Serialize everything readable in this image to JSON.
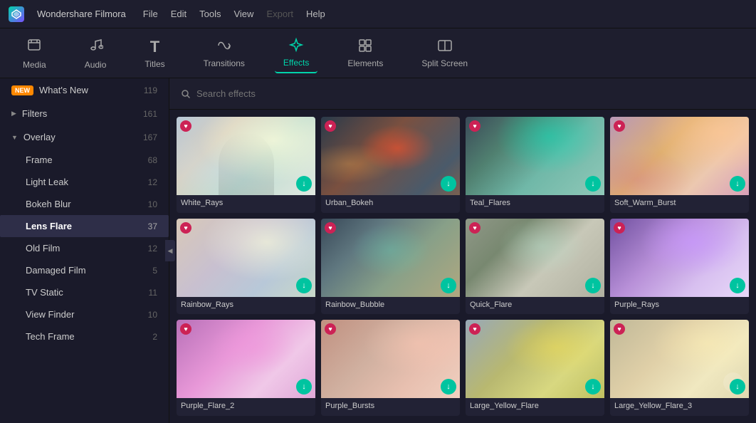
{
  "app": {
    "logo": "W",
    "name": "Wondershare Filmora",
    "menu": [
      "File",
      "Edit",
      "Tools",
      "View",
      "Export",
      "Help"
    ]
  },
  "toolbar": {
    "items": [
      {
        "id": "media",
        "label": "Media",
        "icon": "🗂"
      },
      {
        "id": "audio",
        "label": "Audio",
        "icon": "♪"
      },
      {
        "id": "titles",
        "label": "Titles",
        "icon": "T"
      },
      {
        "id": "transitions",
        "label": "Transitions",
        "icon": "↔"
      },
      {
        "id": "effects",
        "label": "Effects",
        "icon": "✦",
        "active": true
      },
      {
        "id": "elements",
        "label": "Elements",
        "icon": "⬜"
      },
      {
        "id": "split-screen",
        "label": "Split Screen",
        "icon": "⬛"
      }
    ]
  },
  "sidebar": {
    "items": [
      {
        "id": "whats-new",
        "label": "What's New",
        "count": "119",
        "badge": "NEW",
        "indent": 0,
        "arrow": ""
      },
      {
        "id": "filters",
        "label": "Filters",
        "count": "161",
        "indent": 0,
        "arrow": "▶"
      },
      {
        "id": "overlay",
        "label": "Overlay",
        "count": "167",
        "indent": 0,
        "arrow": "▼",
        "expanded": true
      },
      {
        "id": "frame",
        "label": "Frame",
        "count": "68",
        "indent": 1
      },
      {
        "id": "light-leak",
        "label": "Light Leak",
        "count": "12",
        "indent": 1
      },
      {
        "id": "bokeh-blur",
        "label": "Bokeh Blur",
        "count": "10",
        "indent": 1
      },
      {
        "id": "lens-flare",
        "label": "Lens Flare",
        "count": "37",
        "indent": 1,
        "active": true
      },
      {
        "id": "old-film",
        "label": "Old Film",
        "count": "12",
        "indent": 1
      },
      {
        "id": "damaged-film",
        "label": "Damaged Film",
        "count": "5",
        "indent": 1
      },
      {
        "id": "tv-static",
        "label": "TV Static",
        "count": "11",
        "indent": 1
      },
      {
        "id": "view-finder",
        "label": "View Finder",
        "count": "10",
        "indent": 1
      },
      {
        "id": "tech-frame",
        "label": "Tech Frame",
        "count": "2",
        "indent": 1
      }
    ]
  },
  "search": {
    "placeholder": "Search effects"
  },
  "effects": [
    {
      "id": "white-rays",
      "label": "White_Rays",
      "grad": "grad-white",
      "overlay": "overlay-rays"
    },
    {
      "id": "urban-bokeh",
      "label": "Urban_Bokeh",
      "grad": "grad-urban",
      "overlay": "overlay-bokeh"
    },
    {
      "id": "teal-flares",
      "label": "Teal_Flares",
      "grad": "grad-teal",
      "overlay": "overlay-teal"
    },
    {
      "id": "soft-warm-burst",
      "label": "Soft_Warm_Burst",
      "grad": "grad-soft-warm",
      "overlay": "overlay-warm"
    },
    {
      "id": "rainbow-rays",
      "label": "Rainbow_Rays",
      "grad": "grad-rainbow-rays",
      "overlay": "overlay-rays"
    },
    {
      "id": "rainbow-bubble",
      "label": "Rainbow_Bubble",
      "grad": "grad-rainbow-bubble",
      "overlay": "overlay-teal"
    },
    {
      "id": "quick-flare",
      "label": "Quick_Flare",
      "grad": "grad-quick-flare",
      "overlay": "overlay-teal"
    },
    {
      "id": "purple-rays",
      "label": "Purple_Rays",
      "grad": "grad-purple-rays",
      "overlay": "overlay-purple"
    },
    {
      "id": "purple-flare2",
      "label": "Purple_Flare_2",
      "grad": "grad-purple-flare2",
      "overlay": "overlay-purple"
    },
    {
      "id": "purple-bursts",
      "label": "Purple_Bursts",
      "grad": "grad-purple-bursts",
      "overlay": "overlay-warm"
    },
    {
      "id": "large-yellow-flare",
      "label": "Large_Yellow_Flare",
      "grad": "grad-large-yellow",
      "overlay": "overlay-teal"
    },
    {
      "id": "large-yellow-flare3",
      "label": "Large_Yellow_Flare_3",
      "grad": "grad-large-yellow3",
      "overlay": "overlay-rays"
    }
  ]
}
